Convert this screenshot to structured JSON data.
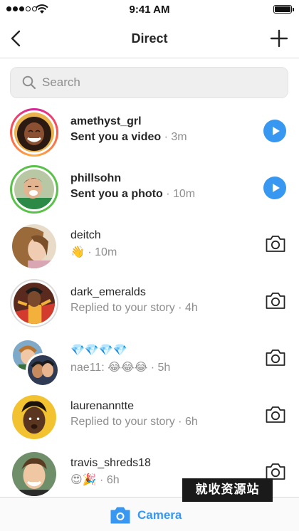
{
  "status_bar": {
    "time": "9:41 AM",
    "signal_bars": 3,
    "signal_total": 5,
    "battery_level": 1.0
  },
  "nav": {
    "title": "Direct",
    "back_icon": "chevron-left-icon",
    "new_icon": "plus-icon"
  },
  "search": {
    "placeholder": "Search",
    "value": ""
  },
  "threads": [
    {
      "username": "amethyst_grl",
      "unread": true,
      "message": "Sent you a video",
      "separator": " · ",
      "time": "3m",
      "action": "play"
    },
    {
      "username": "phillsohn",
      "unread": true,
      "message": "Sent you a photo",
      "separator": " · ",
      "time": "10m",
      "action": "play"
    },
    {
      "username": "deitch",
      "unread": false,
      "message": "👋",
      "separator": " · ",
      "time": "10m",
      "action": "camera"
    },
    {
      "username": "dark_emeralds",
      "unread": false,
      "message": "Replied to your story",
      "separator": " · ",
      "time": "4h",
      "action": "camera"
    },
    {
      "username": "💎💎💎💎",
      "unread": false,
      "message": "nae11: 😂😂😂",
      "separator": " · ",
      "time": "5h",
      "action": "camera"
    },
    {
      "username": "laurenanntte",
      "unread": false,
      "message": "Replied to your story",
      "separator": " · ",
      "time": "6h",
      "action": "camera"
    },
    {
      "username": "travis_shreds18",
      "unread": false,
      "message": "😍🎉",
      "separator": " · ",
      "time": "6h",
      "action": "camera"
    }
  ],
  "bottom_bar": {
    "camera_label": "Camera",
    "camera_icon": "camera-icon"
  },
  "watermark": "就收资源站",
  "colors": {
    "accent": "#3897f0",
    "text": "#262626",
    "secondary": "#8e8e8e",
    "divider": "#dbdbdb",
    "online_ring": "#5cc14b"
  }
}
